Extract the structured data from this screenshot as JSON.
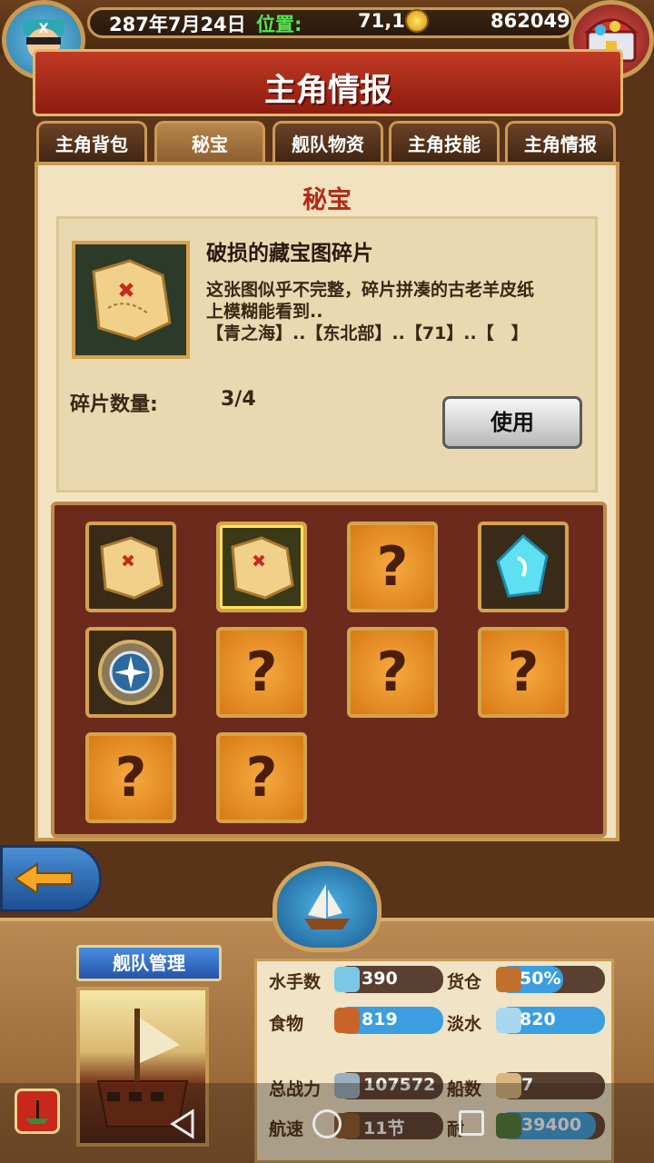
{
  "header": {
    "date": "287年7月24日",
    "position_label": "位置:",
    "position_value": "71,1",
    "gold": "862049"
  },
  "title": "主角情报",
  "tabs": [
    {
      "label": "主角背包",
      "active": false
    },
    {
      "label": "秘宝",
      "active": true
    },
    {
      "label": "舰队物资",
      "active": false
    },
    {
      "label": "主角技能",
      "active": false
    },
    {
      "label": "主角情报",
      "active": false
    }
  ],
  "section_title": "秘宝",
  "item": {
    "name": "破损的藏宝图碎片",
    "desc_line1": "这张图似乎不完整，碎片拼凑的古老羊皮纸",
    "desc_line2": "上模糊能看到..",
    "desc_line3": "【青之海】..【东北部】..【71】..【　】",
    "count_label": "碎片数量:",
    "count_value": "3/4",
    "use_label": "使用"
  },
  "grid": {
    "slots": [
      {
        "kind": "map",
        "selected": false
      },
      {
        "kind": "map",
        "selected": true
      },
      {
        "kind": "unknown",
        "label": "?"
      },
      {
        "kind": "crystal"
      },
      {
        "kind": "compass"
      },
      {
        "kind": "unknown",
        "label": "?"
      },
      {
        "kind": "unknown",
        "label": "?"
      },
      {
        "kind": "unknown",
        "label": "?"
      },
      {
        "kind": "unknown",
        "label": "?"
      },
      {
        "kind": "unknown",
        "label": "?"
      }
    ]
  },
  "fleet": {
    "tag": "舰队管理",
    "stats": [
      {
        "label": "水手数",
        "value": "390"
      },
      {
        "label": "货仓",
        "value": "50%"
      },
      {
        "label": "食物",
        "value": "819"
      },
      {
        "label": "淡水",
        "value": "820"
      },
      {
        "label": "总战力",
        "value": "107572"
      },
      {
        "label": "船数",
        "value": "7"
      },
      {
        "label": "航速",
        "value": "11节"
      },
      {
        "label": "耐",
        "value": "39400"
      }
    ]
  },
  "colors": {
    "accent_red": "#b32a18",
    "gold_border": "#d6a24c",
    "panel_bg": "#f2e2c0"
  }
}
